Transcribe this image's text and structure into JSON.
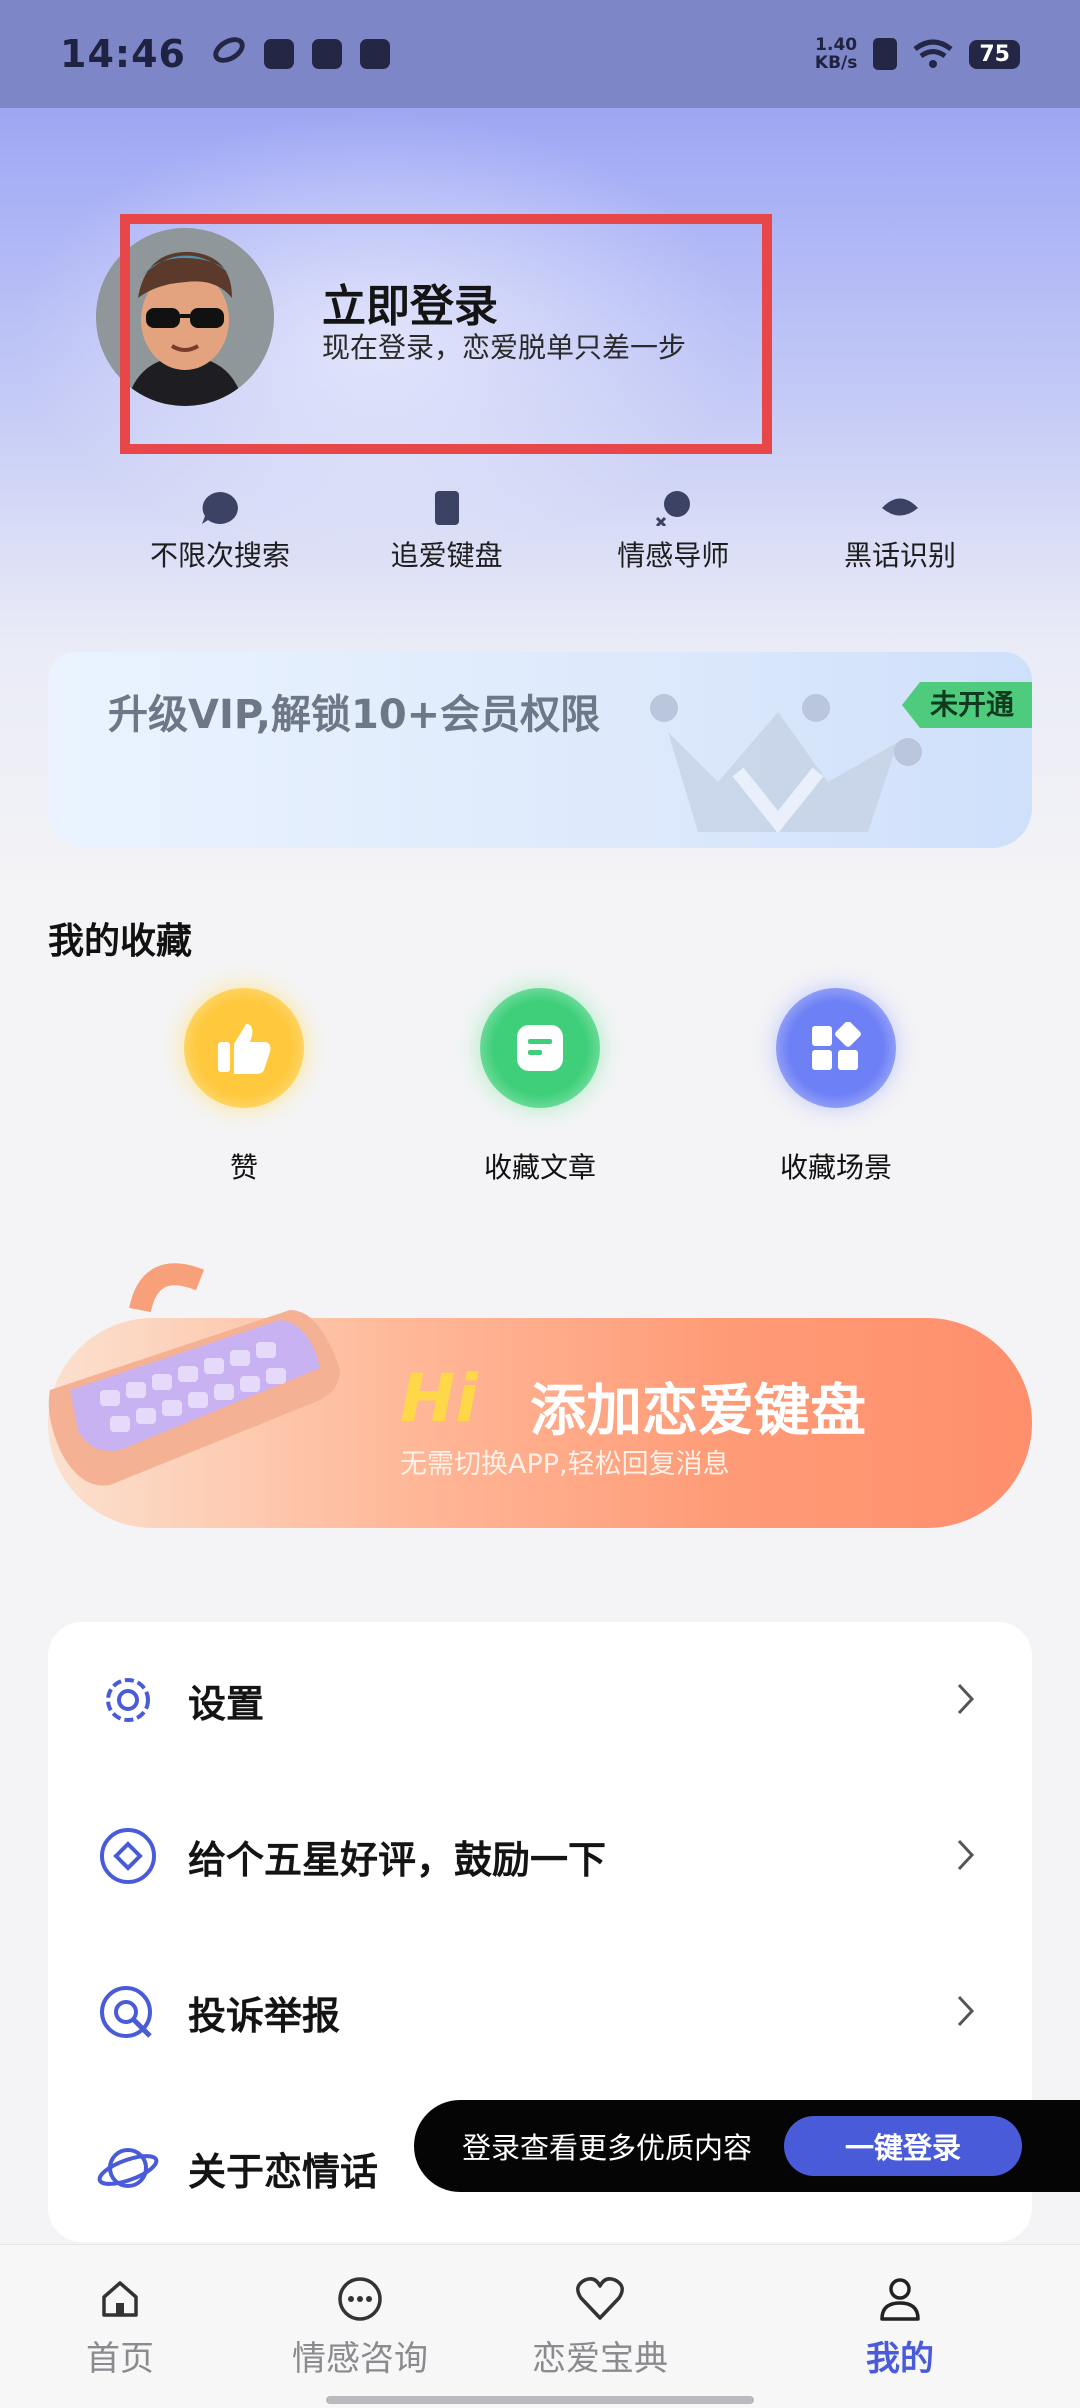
{
  "status_bar": {
    "time": "14:46",
    "net_speed_value": "1.40",
    "net_speed_unit": "KB/s",
    "battery": "75"
  },
  "profile": {
    "title": "立即登录",
    "subtitle": "现在登录，恋爱脱单只差一步"
  },
  "features": [
    {
      "label": "不限次搜索",
      "icon": "speech-bubble-icon"
    },
    {
      "label": "追爱键盘",
      "icon": "phone-icon"
    },
    {
      "label": "情感导师",
      "icon": "mentor-icon"
    },
    {
      "label": "黑话识别",
      "icon": "eye-icon"
    }
  ],
  "vip": {
    "text": "升级VIP,解锁10+会员权限",
    "badge": "未开通"
  },
  "favorites": {
    "title": "我的收藏",
    "items": [
      {
        "label": "赞",
        "icon": "thumbs-up-icon",
        "color": "#ffc83d"
      },
      {
        "label": "收藏文章",
        "icon": "article-icon",
        "color": "#3fcf7a"
      },
      {
        "label": "收藏场景",
        "icon": "grid-icon",
        "color": "#6d80f5"
      }
    ]
  },
  "keyboard_banner": {
    "hi": "Hi",
    "title": "添加恋爱键盘",
    "subtitle": "无需切换APP,轻松回复消息"
  },
  "settings": [
    {
      "label": "设置",
      "icon": "gear-icon"
    },
    {
      "label": "给个五星好评，鼓励一下",
      "icon": "diamond-icon"
    },
    {
      "label": "投诉举报",
      "icon": "report-icon"
    },
    {
      "label": "关于恋情话",
      "icon": "planet-icon"
    }
  ],
  "login_prompt": {
    "text": "登录查看更多优质内容",
    "button": "一键登录"
  },
  "nav": [
    {
      "label": "首页",
      "icon": "home-icon"
    },
    {
      "label": "情感咨询",
      "icon": "chat-icon"
    },
    {
      "label": "恋爱宝典",
      "icon": "heart-icon"
    },
    {
      "label": "我的",
      "icon": "profile-icon"
    }
  ],
  "colors": {
    "accent": "#4a5bd9",
    "highlight_box": "#e8474a",
    "vip_badge": "#4ecb7d"
  }
}
